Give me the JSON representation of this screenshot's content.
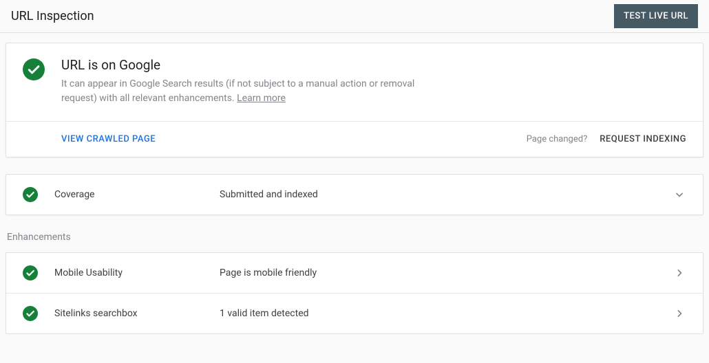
{
  "header": {
    "title": "URL Inspection",
    "test_button": "TEST LIVE URL"
  },
  "main": {
    "title": "URL is on Google",
    "description_prefix": "It can appear in Google Search results (if not subject to a manual action or removal request) with all relevant enhancements. ",
    "learn_more": "Learn more",
    "view_crawled": "VIEW CRAWLED PAGE",
    "page_changed": "Page changed?",
    "request_indexing": "REQUEST INDEXING"
  },
  "coverage": {
    "label": "Coverage",
    "value": "Submitted and indexed"
  },
  "enhancements": {
    "heading": "Enhancements",
    "items": [
      {
        "label": "Mobile Usability",
        "value": "Page is mobile friendly"
      },
      {
        "label": "Sitelinks searchbox",
        "value": "1 valid item detected"
      }
    ]
  }
}
